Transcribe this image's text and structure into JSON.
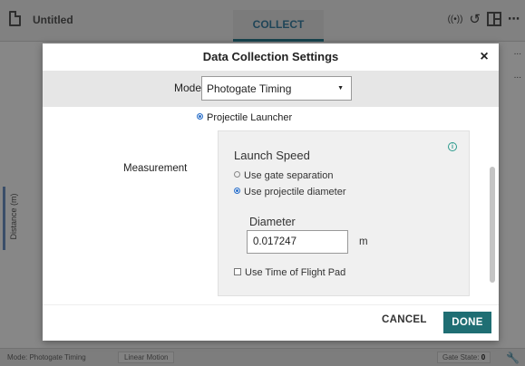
{
  "app": {
    "doc_title": "Untitled",
    "active_tab": "COLLECT",
    "icons": [
      "file-icon",
      "wireless-icon",
      "undo-icon",
      "layout-icon",
      "more-icon"
    ]
  },
  "background": {
    "axis_label": "Distance (m)",
    "more_label": "..."
  },
  "status": {
    "mode": "Mode: Photogate Timing",
    "motion": "Linear Motion",
    "gate_state_label": "Gate State:",
    "gate_state_value": "0"
  },
  "dialog": {
    "title": "Data Collection Settings",
    "close_label": "×",
    "mode_label": "Mode",
    "mode_value": "Photogate Timing",
    "launcher_option": "Projectile Launcher",
    "measurement_label": "Measurement",
    "launch_speed_title": "Launch Speed",
    "option_gate_separation": "Use gate separation",
    "option_projectile_diameter": "Use projectile diameter",
    "diameter_label": "Diameter",
    "diameter_value": "0.017247",
    "diameter_unit": "m",
    "time_of_flight_label": "Use Time of Flight Pad",
    "cancel_label": "CANCEL",
    "done_label": "DONE"
  },
  "colors": {
    "accent": "#1f6e73",
    "radio_selected": "#2a6fc9",
    "info": "#2a9a8c"
  }
}
